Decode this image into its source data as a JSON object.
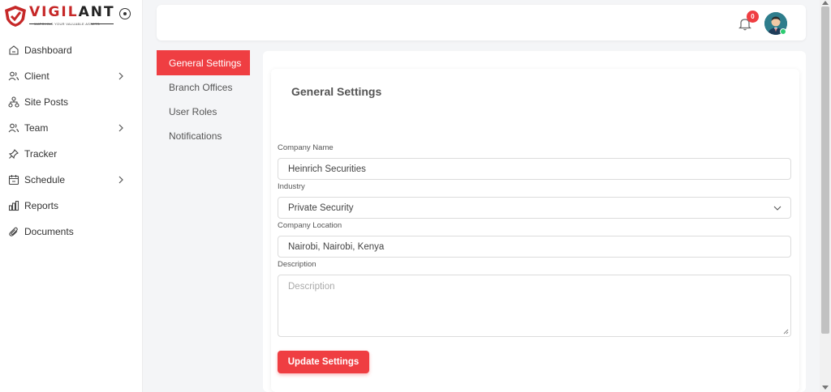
{
  "brand": {
    "name_part1": "VIGIL",
    "name_part2": "ANT",
    "tagline": "WATCHING YOUR VALUABLE ASSETS",
    "accent_color": "#ef3e42"
  },
  "sidebar": {
    "items": [
      {
        "label": "Dashboard",
        "icon": "home-icon",
        "has_submenu": false
      },
      {
        "label": "Client",
        "icon": "users-icon",
        "has_submenu": true
      },
      {
        "label": "Site Posts",
        "icon": "sitemap-icon",
        "has_submenu": false
      },
      {
        "label": "Team",
        "icon": "users-icon",
        "has_submenu": true
      },
      {
        "label": "Tracker",
        "icon": "pin-icon",
        "has_submenu": false
      },
      {
        "label": "Schedule",
        "icon": "calendar-icon",
        "has_submenu": true
      },
      {
        "label": "Reports",
        "icon": "bar-chart-icon",
        "has_submenu": false
      },
      {
        "label": "Documents",
        "icon": "paperclip-icon",
        "has_submenu": false
      }
    ]
  },
  "header": {
    "notification_count": "0"
  },
  "settings_menu": {
    "items": [
      {
        "label": "General Settings",
        "active": true
      },
      {
        "label": "Branch Offices",
        "active": false
      },
      {
        "label": "User Roles",
        "active": false
      },
      {
        "label": "Notifications",
        "active": false
      }
    ]
  },
  "form": {
    "title": "General Settings",
    "company_name": {
      "label": "Company Name",
      "value": "Heinrich Securities"
    },
    "industry": {
      "label": "Industry",
      "value": "Private Security"
    },
    "company_location": {
      "label": "Company Location",
      "value": "Nairobi, Nairobi, Kenya"
    },
    "description": {
      "label": "Description",
      "placeholder": "Description",
      "value": ""
    },
    "submit_label": "Update Settings"
  }
}
